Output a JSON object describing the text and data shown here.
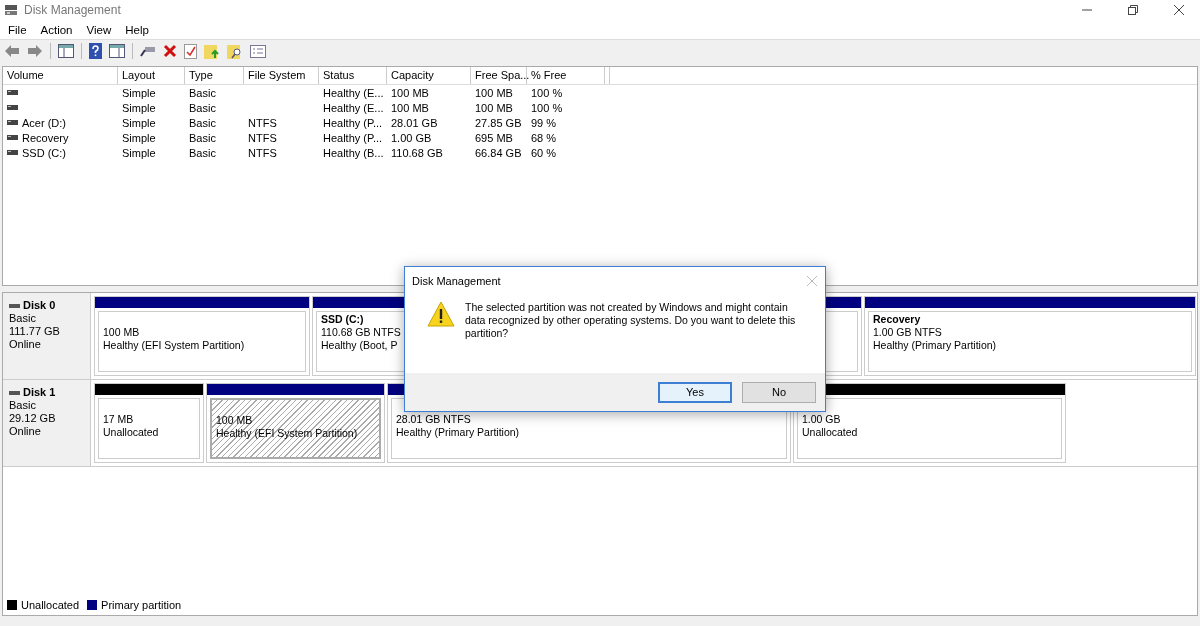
{
  "window": {
    "title": "Disk Management"
  },
  "menu": [
    "File",
    "Action",
    "View",
    "Help"
  ],
  "table": {
    "columns": [
      "Volume",
      "Layout",
      "Type",
      "File System",
      "Status",
      "Capacity",
      "Free Spa...",
      "% Free"
    ],
    "rows": [
      {
        "cells": [
          "",
          "Simple",
          "Basic",
          "",
          "Healthy (E...",
          "100 MB",
          "100 MB",
          "100 %"
        ]
      },
      {
        "cells": [
          "",
          "Simple",
          "Basic",
          "",
          "Healthy (E...",
          "100 MB",
          "100 MB",
          "100 %"
        ]
      },
      {
        "cells": [
          "Acer (D:)",
          "Simple",
          "Basic",
          "NTFS",
          "Healthy (P...",
          "28.01 GB",
          "27.85 GB",
          "99 %"
        ]
      },
      {
        "cells": [
          "Recovery",
          "Simple",
          "Basic",
          "NTFS",
          "Healthy (P...",
          "1.00 GB",
          "695 MB",
          "68 %"
        ]
      },
      {
        "cells": [
          "SSD (C:)",
          "Simple",
          "Basic",
          "NTFS",
          "Healthy (B...",
          "110.68 GB",
          "66.84 GB",
          "60 %"
        ]
      }
    ]
  },
  "disks": [
    {
      "name": "Disk 0",
      "type": "Basic",
      "size": "111.77 GB",
      "status": "Online",
      "partitions": [
        {
          "kind": "primary",
          "selected": false,
          "lines": [
            "100 MB",
            "Healthy (EFI System Partition)"
          ]
        },
        {
          "kind": "primary",
          "selected": false,
          "title": "SSD  (C:)",
          "lines": [
            "110.68 GB NTFS",
            "Healthy (Boot, P"
          ]
        },
        {
          "kind": "primary",
          "selected": false
        },
        {
          "kind": "primary",
          "selected": false,
          "title": "Recovery",
          "lines": [
            "1.00 GB NTFS",
            "Healthy (Primary Partition)"
          ]
        }
      ]
    },
    {
      "name": "Disk 1",
      "type": "Basic",
      "size": "29.12 GB",
      "status": "Online",
      "partitions": [
        {
          "kind": "unallocated",
          "selected": false,
          "lines": [
            "17 MB",
            "Unallocated"
          ]
        },
        {
          "kind": "primary",
          "selected": true,
          "lines": [
            "100 MB",
            "Healthy (EFI System Partition)"
          ]
        },
        {
          "kind": "primary",
          "selected": false,
          "lines": [
            "28.01 GB NTFS",
            "Healthy (Primary Partition)"
          ]
        },
        {
          "kind": "unallocated",
          "selected": false,
          "lines": [
            "1.00 GB",
            "Unallocated"
          ]
        }
      ]
    }
  ],
  "legend": [
    {
      "label": "Unallocated",
      "color": "#000000"
    },
    {
      "label": "Primary partition",
      "color": "#000080"
    }
  ],
  "dialog": {
    "title": "Disk Management",
    "message": "The selected partition was not created by Windows and might contain data recognized by other operating systems. Do you want to delete this partition?",
    "buttons": [
      {
        "label": "Yes",
        "selected": true
      },
      {
        "label": "No",
        "selected": false
      }
    ]
  }
}
